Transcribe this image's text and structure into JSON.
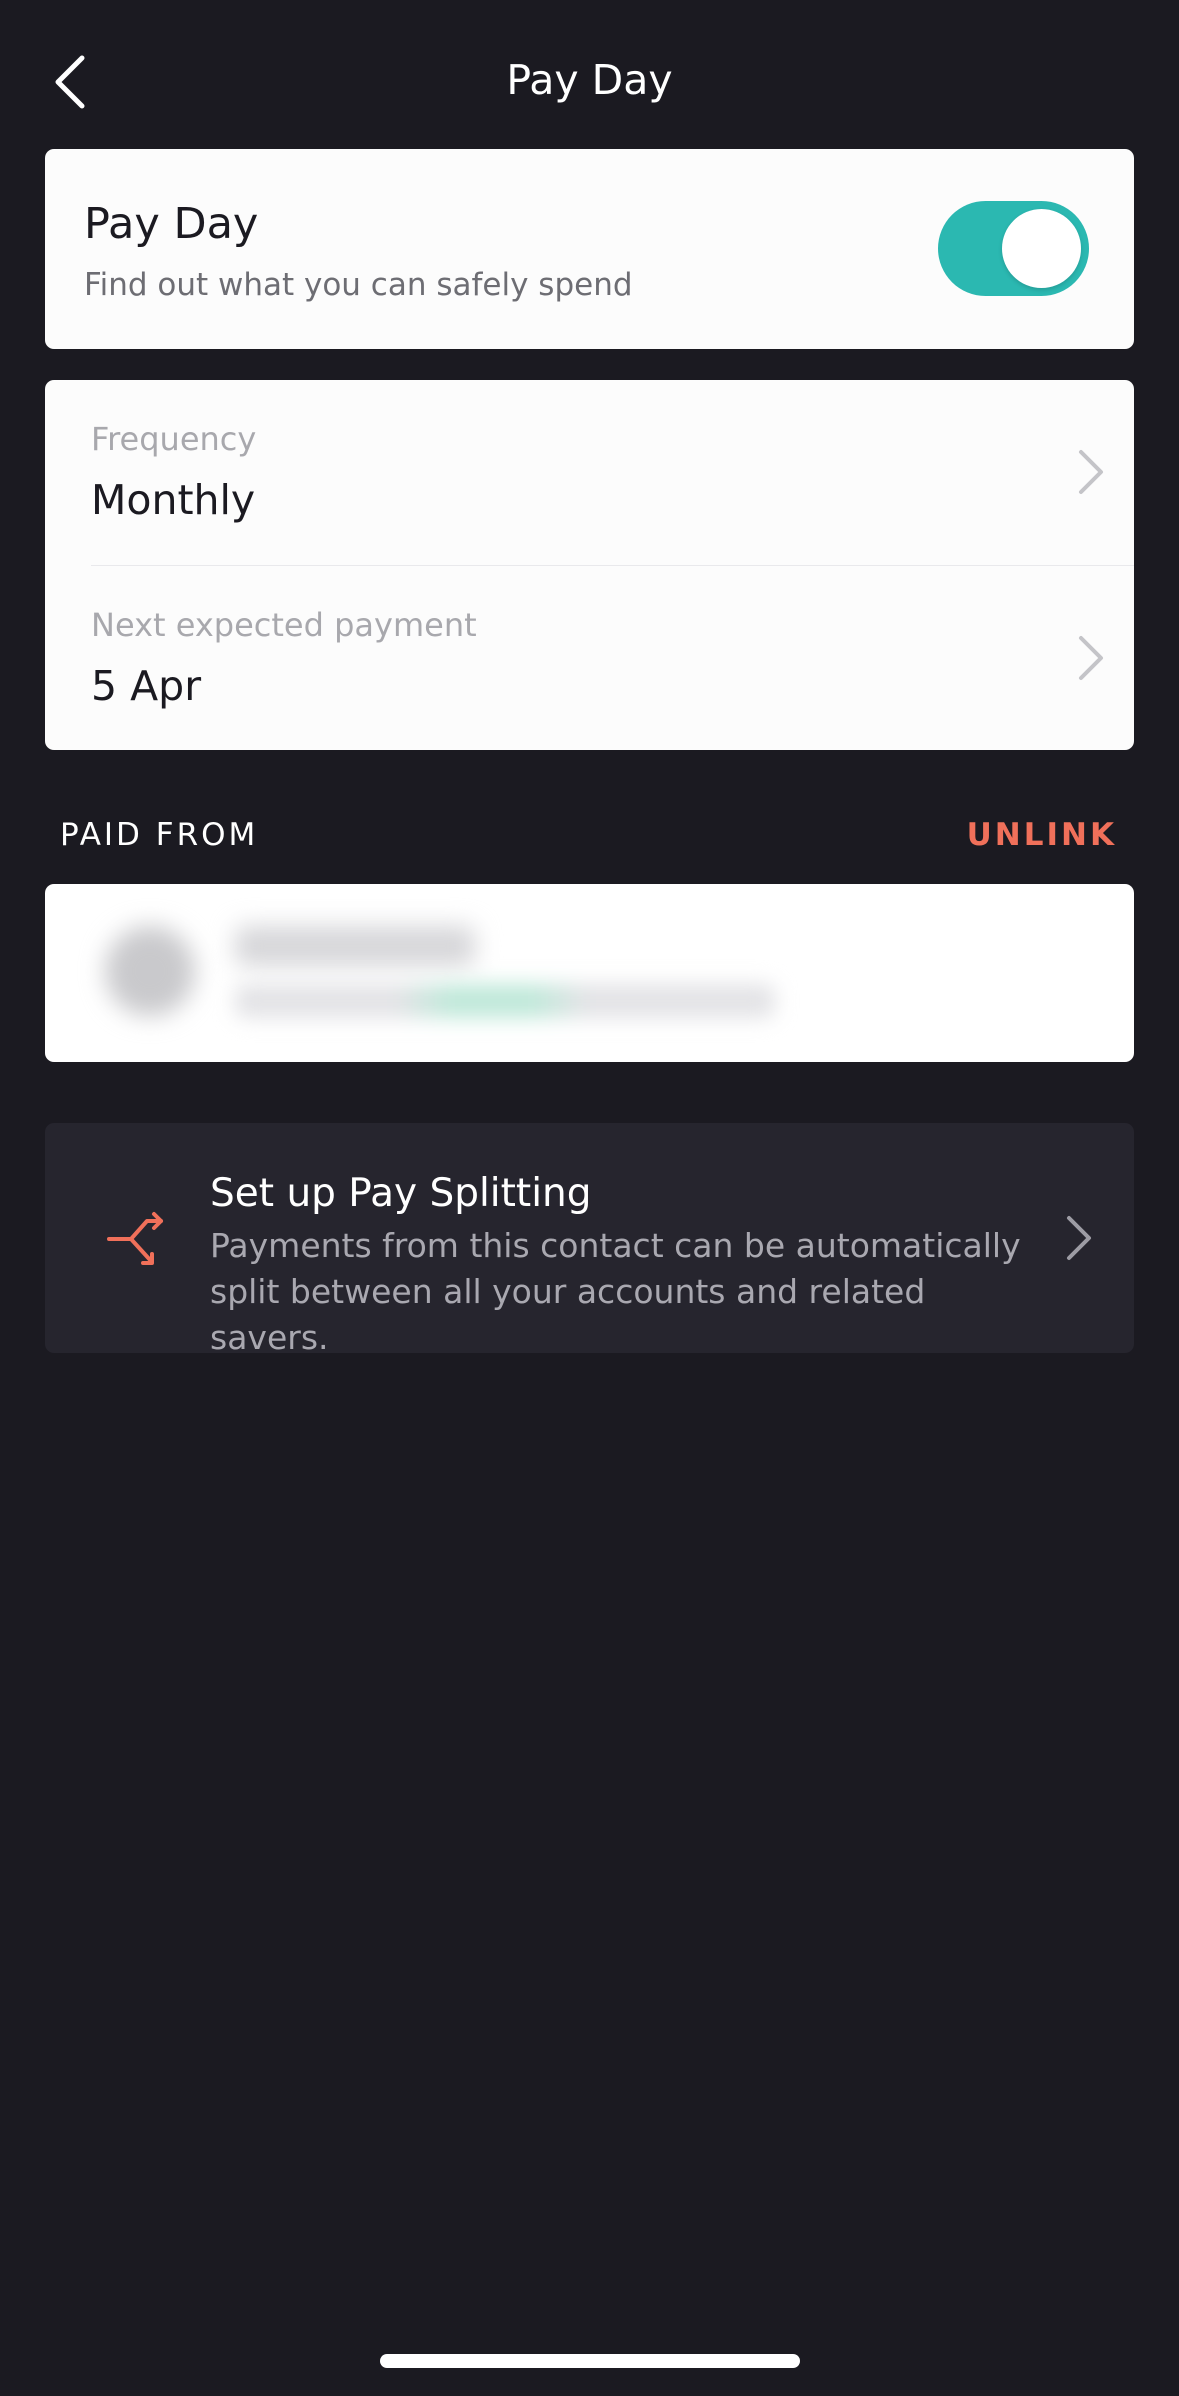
{
  "nav": {
    "title": "Pay Day",
    "back_icon": "chevron-left-icon"
  },
  "payday": {
    "title": "Pay Day",
    "description": "Find out what you can safely spend",
    "toggle_on": true,
    "toggle_color": "#2bb8b1"
  },
  "settings": {
    "frequency": {
      "label": "Frequency",
      "value": "Monthly"
    },
    "next_payment": {
      "label": "Next expected payment",
      "value": "5 Apr"
    }
  },
  "paid_from": {
    "header": "PAID FROM",
    "unlink_label": "UNLINK",
    "unlink_color": "#f0705a"
  },
  "pay_splitting": {
    "title": "Set up Pay Splitting",
    "description": "Payments from this contact can be automatically split between all your accounts and related savers.",
    "icon": "split-arrows-icon"
  },
  "colors": {
    "background": "#1b1a21",
    "card": "#fcfcfc",
    "dark_card": "#26252e"
  }
}
